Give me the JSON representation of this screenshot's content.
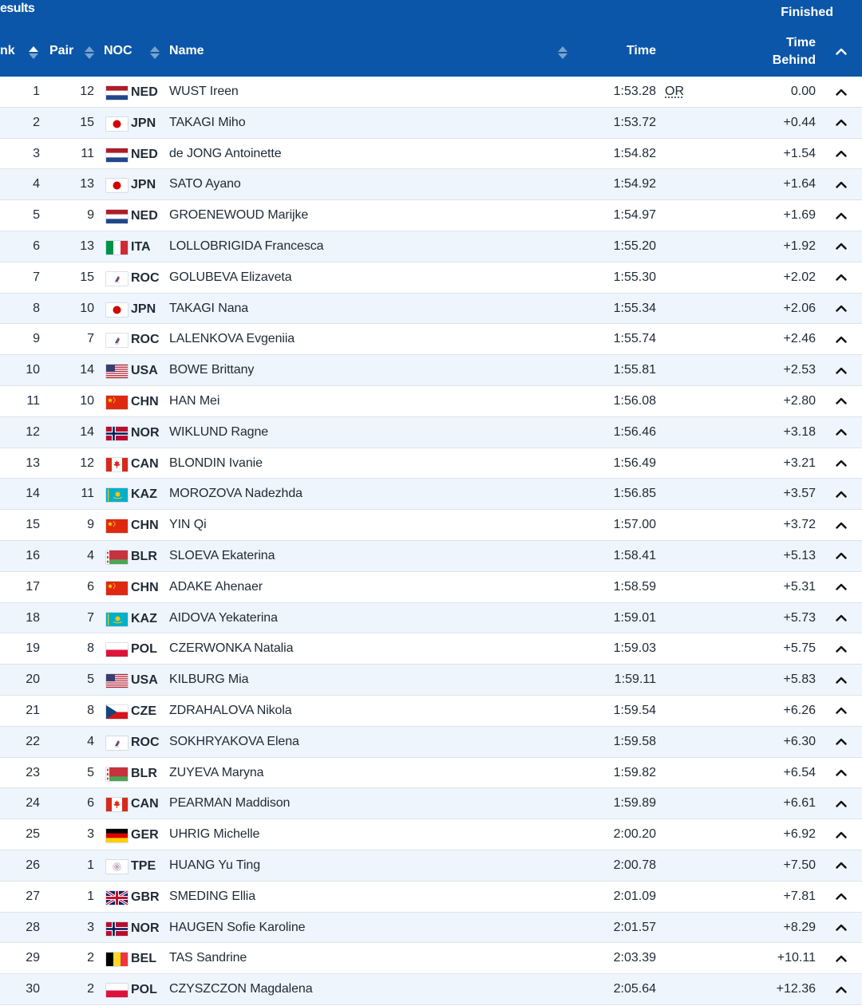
{
  "header": {
    "title": "esults",
    "status": "Finished",
    "columns": {
      "rank": "nk",
      "pair": "Pair",
      "noc": "NOC",
      "name": "Name",
      "time": "Time",
      "behind_line1": "Time",
      "behind_line2": "Behind"
    }
  },
  "colors": {
    "header_bg": "#0b56a8",
    "row_alt_bg": "#eef5fd",
    "text": "#1f2a36"
  },
  "rows": [
    {
      "rank": "1",
      "pair": "12",
      "noc": "NED",
      "name": "WUST Ireen",
      "time": "1:53.28",
      "record": "OR",
      "behind": "0.00"
    },
    {
      "rank": "2",
      "pair": "15",
      "noc": "JPN",
      "name": "TAKAGI Miho",
      "time": "1:53.72",
      "record": "",
      "behind": "+0.44"
    },
    {
      "rank": "3",
      "pair": "11",
      "noc": "NED",
      "name": "de JONG Antoinette",
      "time": "1:54.82",
      "record": "",
      "behind": "+1.54"
    },
    {
      "rank": "4",
      "pair": "13",
      "noc": "JPN",
      "name": "SATO Ayano",
      "time": "1:54.92",
      "record": "",
      "behind": "+1.64"
    },
    {
      "rank": "5",
      "pair": "9",
      "noc": "NED",
      "name": "GROENEWOUD Marijke",
      "time": "1:54.97",
      "record": "",
      "behind": "+1.69"
    },
    {
      "rank": "6",
      "pair": "13",
      "noc": "ITA",
      "name": "LOLLOBRIGIDA Francesca",
      "time": "1:55.20",
      "record": "",
      "behind": "+1.92"
    },
    {
      "rank": "7",
      "pair": "15",
      "noc": "ROC",
      "name": "GOLUBEVA Elizaveta",
      "time": "1:55.30",
      "record": "",
      "behind": "+2.02"
    },
    {
      "rank": "8",
      "pair": "10",
      "noc": "JPN",
      "name": "TAKAGI Nana",
      "time": "1:55.34",
      "record": "",
      "behind": "+2.06"
    },
    {
      "rank": "9",
      "pair": "7",
      "noc": "ROC",
      "name": "LALENKOVA Evgeniia",
      "time": "1:55.74",
      "record": "",
      "behind": "+2.46"
    },
    {
      "rank": "10",
      "pair": "14",
      "noc": "USA",
      "name": "BOWE Brittany",
      "time": "1:55.81",
      "record": "",
      "behind": "+2.53"
    },
    {
      "rank": "11",
      "pair": "10",
      "noc": "CHN",
      "name": "HAN Mei",
      "time": "1:56.08",
      "record": "",
      "behind": "+2.80"
    },
    {
      "rank": "12",
      "pair": "14",
      "noc": "NOR",
      "name": "WIKLUND Ragne",
      "time": "1:56.46",
      "record": "",
      "behind": "+3.18"
    },
    {
      "rank": "13",
      "pair": "12",
      "noc": "CAN",
      "name": "BLONDIN Ivanie",
      "time": "1:56.49",
      "record": "",
      "behind": "+3.21"
    },
    {
      "rank": "14",
      "pair": "11",
      "noc": "KAZ",
      "name": "MOROZOVA Nadezhda",
      "time": "1:56.85",
      "record": "",
      "behind": "+3.57"
    },
    {
      "rank": "15",
      "pair": "9",
      "noc": "CHN",
      "name": "YIN Qi",
      "time": "1:57.00",
      "record": "",
      "behind": "+3.72"
    },
    {
      "rank": "16",
      "pair": "4",
      "noc": "BLR",
      "name": "SLOEVA Ekaterina",
      "time": "1:58.41",
      "record": "",
      "behind": "+5.13"
    },
    {
      "rank": "17",
      "pair": "6",
      "noc": "CHN",
      "name": "ADAKE Ahenaer",
      "time": "1:58.59",
      "record": "",
      "behind": "+5.31"
    },
    {
      "rank": "18",
      "pair": "7",
      "noc": "KAZ",
      "name": "AIDOVA Yekaterina",
      "time": "1:59.01",
      "record": "",
      "behind": "+5.73"
    },
    {
      "rank": "19",
      "pair": "8",
      "noc": "POL",
      "name": "CZERWONKA Natalia",
      "time": "1:59.03",
      "record": "",
      "behind": "+5.75"
    },
    {
      "rank": "20",
      "pair": "5",
      "noc": "USA",
      "name": "KILBURG Mia",
      "time": "1:59.11",
      "record": "",
      "behind": "+5.83"
    },
    {
      "rank": "21",
      "pair": "8",
      "noc": "CZE",
      "name": "ZDRAHALOVA Nikola",
      "time": "1:59.54",
      "record": "",
      "behind": "+6.26"
    },
    {
      "rank": "22",
      "pair": "4",
      "noc": "ROC",
      "name": "SOKHRYAKOVA Elena",
      "time": "1:59.58",
      "record": "",
      "behind": "+6.30"
    },
    {
      "rank": "23",
      "pair": "5",
      "noc": "BLR",
      "name": "ZUYEVA Maryna",
      "time": "1:59.82",
      "record": "",
      "behind": "+6.54"
    },
    {
      "rank": "24",
      "pair": "6",
      "noc": "CAN",
      "name": "PEARMAN Maddison",
      "time": "1:59.89",
      "record": "",
      "behind": "+6.61"
    },
    {
      "rank": "25",
      "pair": "3",
      "noc": "GER",
      "name": "UHRIG Michelle",
      "time": "2:00.20",
      "record": "",
      "behind": "+6.92"
    },
    {
      "rank": "26",
      "pair": "1",
      "noc": "TPE",
      "name": "HUANG Yu Ting",
      "time": "2:00.78",
      "record": "",
      "behind": "+7.50"
    },
    {
      "rank": "27",
      "pair": "1",
      "noc": "GBR",
      "name": "SMEDING Ellia",
      "time": "2:01.09",
      "record": "",
      "behind": "+7.81"
    },
    {
      "rank": "28",
      "pair": "3",
      "noc": "NOR",
      "name": "HAUGEN Sofie Karoline",
      "time": "2:01.57",
      "record": "",
      "behind": "+8.29"
    },
    {
      "rank": "29",
      "pair": "2",
      "noc": "BEL",
      "name": "TAS Sandrine",
      "time": "2:03.39",
      "record": "",
      "behind": "+10.11"
    },
    {
      "rank": "30",
      "pair": "2",
      "noc": "POL",
      "name": "CZYSZCZON Magdalena",
      "time": "2:05.64",
      "record": "",
      "behind": "+12.36"
    }
  ]
}
